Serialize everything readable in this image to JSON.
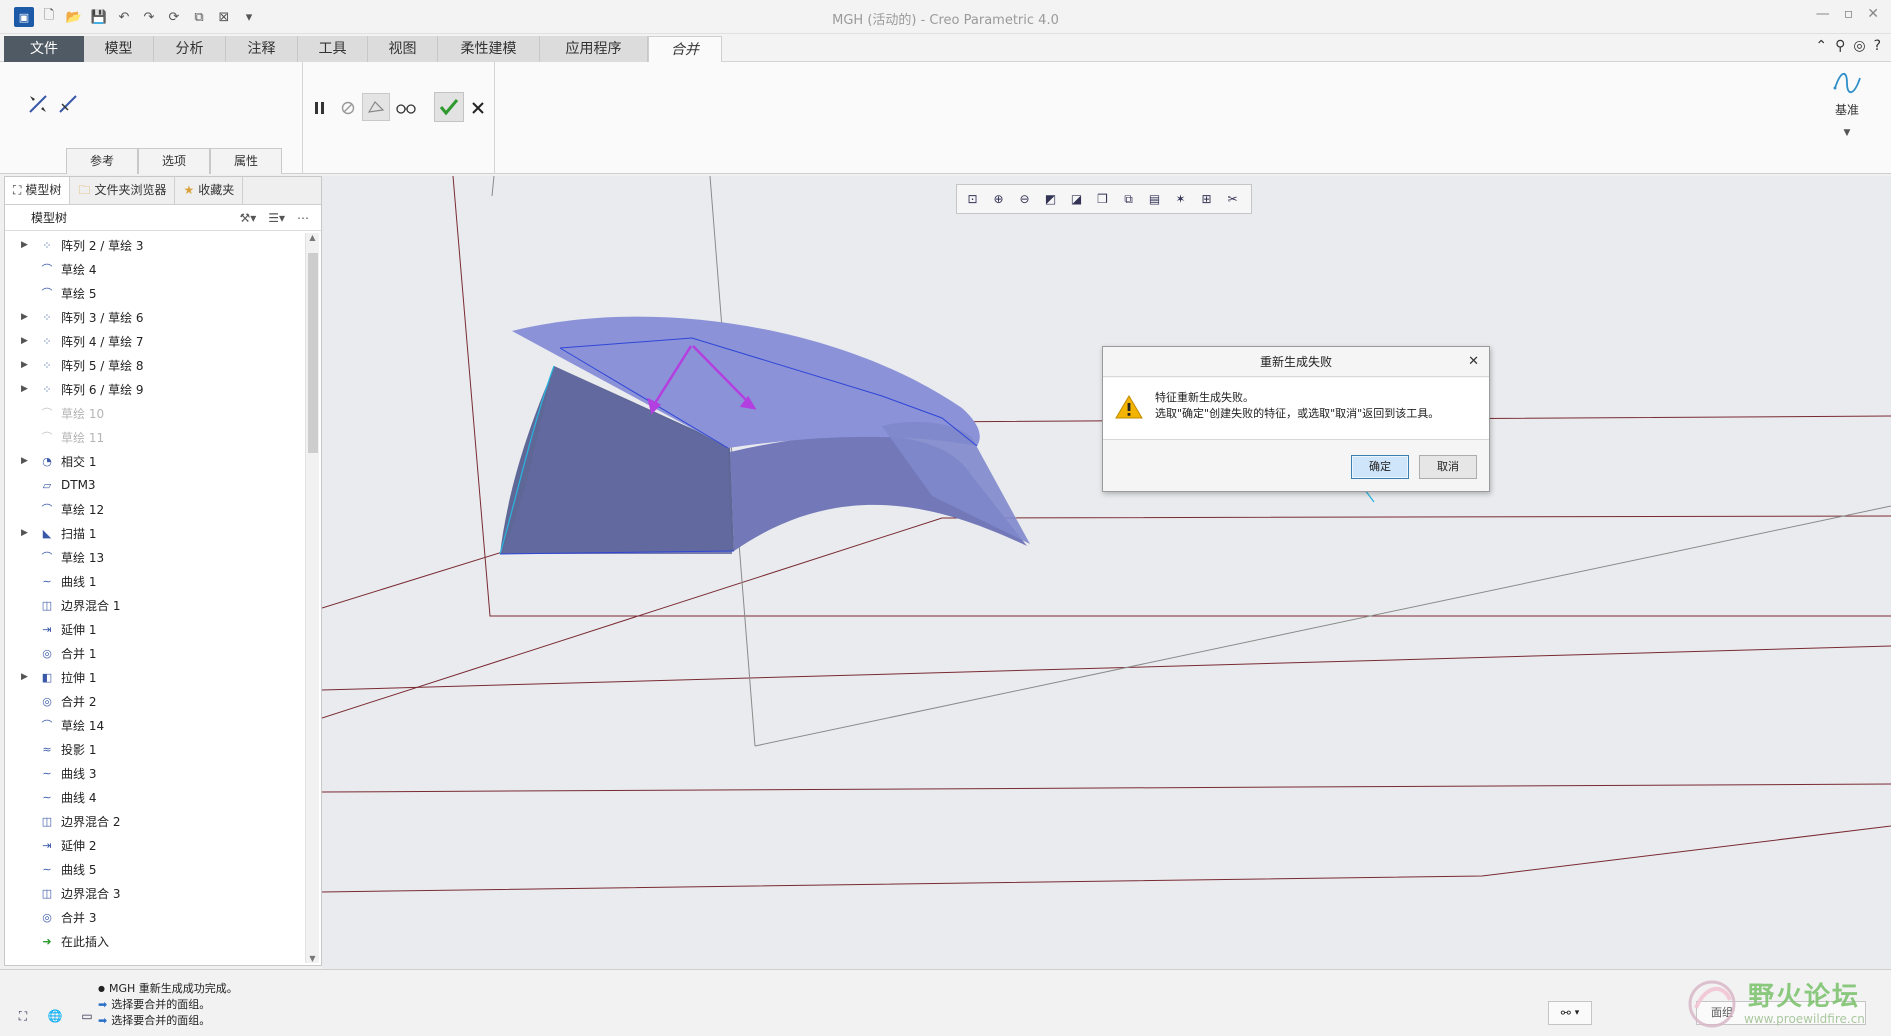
{
  "window": {
    "title": "MGH (活动的) - Creo Parametric 4.0",
    "controls": [
      "minimize",
      "maximize",
      "close"
    ]
  },
  "ribbon_tabs": [
    {
      "label": "文件"
    },
    {
      "label": "模型"
    },
    {
      "label": "分析"
    },
    {
      "label": "注释"
    },
    {
      "label": "工具"
    },
    {
      "label": "视图"
    },
    {
      "label": "柔性建模"
    },
    {
      "label": "应用程序"
    },
    {
      "label": "合并",
      "active": true
    }
  ],
  "ribbon": {
    "subtabs": [
      "参考",
      "选项",
      "属性"
    ],
    "datum_label": "基准"
  },
  "left_panel": {
    "tabs": [
      "模型树",
      "文件夹浏览器",
      "收藏夹"
    ],
    "header": "模型树",
    "tree": [
      {
        "label": "阵列 2 / 草绘 3",
        "expandable": true,
        "icon": "pattern-icon"
      },
      {
        "label": "草绘 4",
        "icon": "sketch-icon"
      },
      {
        "label": "草绘 5",
        "icon": "sketch-icon"
      },
      {
        "label": "阵列 3 / 草绘 6",
        "expandable": true,
        "icon": "pattern-icon"
      },
      {
        "label": "阵列 4 / 草绘 7",
        "expandable": true,
        "icon": "pattern-icon"
      },
      {
        "label": "阵列 5 / 草绘 8",
        "expandable": true,
        "icon": "pattern-icon"
      },
      {
        "label": "阵列 6 / 草绘 9",
        "expandable": true,
        "icon": "pattern-icon"
      },
      {
        "label": "草绘 10",
        "icon": "sketch-icon",
        "disabled": true
      },
      {
        "label": "草绘 11",
        "icon": "sketch-icon",
        "disabled": true
      },
      {
        "label": "相交 1",
        "expandable": true,
        "icon": "intersect-icon"
      },
      {
        "label": "DTM3",
        "icon": "datum-plane-icon"
      },
      {
        "label": "草绘 12",
        "icon": "sketch-icon"
      },
      {
        "label": "扫描 1",
        "expandable": true,
        "icon": "sweep-icon"
      },
      {
        "label": "草绘 13",
        "icon": "sketch-icon"
      },
      {
        "label": "曲线 1",
        "icon": "curve-icon"
      },
      {
        "label": "边界混合 1",
        "icon": "boundary-blend-icon"
      },
      {
        "label": "延伸 1",
        "icon": "extend-icon"
      },
      {
        "label": "合并 1",
        "icon": "merge-icon"
      },
      {
        "label": "拉伸 1",
        "expandable": true,
        "icon": "extrude-icon"
      },
      {
        "label": "合并 2",
        "icon": "merge-icon"
      },
      {
        "label": "草绘 14",
        "icon": "sketch-icon"
      },
      {
        "label": "投影 1",
        "icon": "projection-icon"
      },
      {
        "label": "曲线 3",
        "icon": "curve-icon"
      },
      {
        "label": "曲线 4",
        "icon": "curve-icon"
      },
      {
        "label": "边界混合 2",
        "icon": "boundary-blend-icon"
      },
      {
        "label": "延伸 2",
        "icon": "extend-icon"
      },
      {
        "label": "曲线 5",
        "icon": "curve-icon"
      },
      {
        "label": "边界混合 3",
        "icon": "boundary-blend-icon"
      },
      {
        "label": "合并 3",
        "icon": "merge-icon"
      },
      {
        "label": "在此插入",
        "icon": "insert-here-icon"
      }
    ]
  },
  "dialog": {
    "title": "重新生成失败",
    "message_line1": "特征重新生成失败。",
    "message_line2": "选取\"确定\"创建失败的特征，或选取\"取消\"返回到该工具。",
    "ok_label": "确定",
    "cancel_label": "取消"
  },
  "status": {
    "messages": [
      "MGH 重新生成成功完成。",
      "选择要合并的面组。",
      "选择要合并的面组。"
    ],
    "selection_filter": "面组"
  },
  "watermark": {
    "text": "野火论坛",
    "url": "www.proewildfire.cn"
  },
  "colors": {
    "file_tab": "#4f5a65",
    "surface": "#7f88cf",
    "datum": "#7a2a33",
    "accent_arrow": "#b43fe0",
    "curve": "#27b5e0"
  }
}
